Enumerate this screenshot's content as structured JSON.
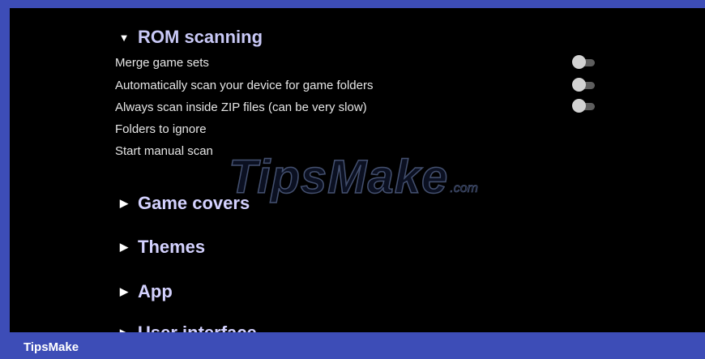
{
  "rom_scanning": {
    "title": "ROM scanning",
    "arrow_icon": "▼",
    "settings": [
      {
        "label": "Merge game sets",
        "toggle_on": false
      },
      {
        "label": "Automatically scan your device for game folders",
        "toggle_on": false
      },
      {
        "label": "Always scan inside ZIP files (can be very slow)",
        "toggle_on": false
      },
      {
        "label": "Folders to ignore"
      },
      {
        "label": "Start manual scan"
      }
    ]
  },
  "collapsed_sections": [
    {
      "title": "Game covers",
      "arrow_icon": "▶"
    },
    {
      "title": "Themes",
      "arrow_icon": "▶"
    },
    {
      "title": "App",
      "arrow_icon": "▶"
    },
    {
      "title": "User interface",
      "arrow_icon": "▶"
    }
  ],
  "watermark": {
    "text": "TipsMake",
    "suffix": ".com"
  },
  "footer": {
    "brand": "TipsMake"
  },
  "colors": {
    "frame": "#3d4db7",
    "screen_bg": "#000000",
    "header_text": "#c9c9f7",
    "setting_text": "#e6e6e6",
    "toggle_thumb": "#d2d2d2",
    "toggle_track": "#5e5e5e"
  }
}
